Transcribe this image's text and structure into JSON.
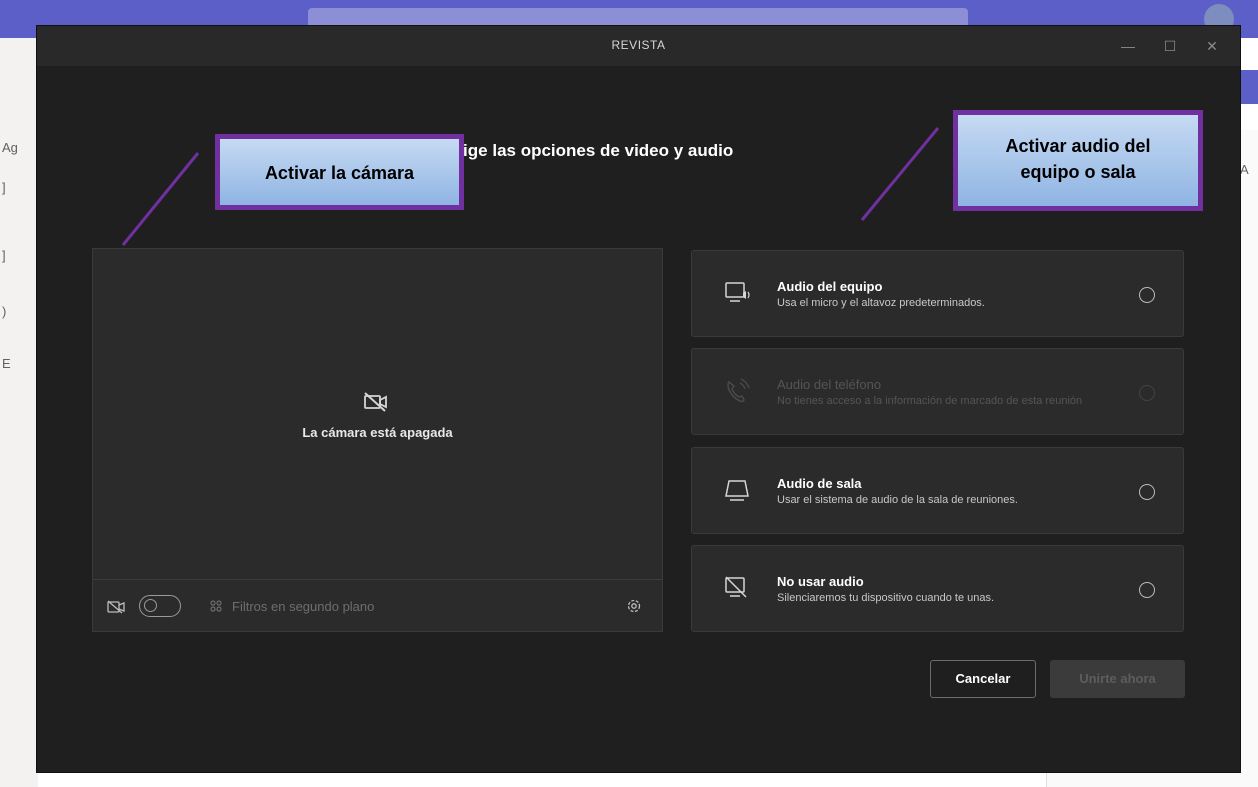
{
  "background_app": {
    "side_glyphs": [
      "Ag",
      "]",
      "]",
      ")",
      "E"
    ],
    "right_letter": "A"
  },
  "dialog": {
    "title": "REVISTA",
    "window_controls": {
      "minimize": "—",
      "maximize": "☐",
      "close": "✕"
    },
    "heading": "Elige las opciones de video y audio"
  },
  "annotations": {
    "camera_callout": "Activar la cámara",
    "audio_callout_line1": "Activar audio del",
    "audio_callout_line2": "equipo o sala",
    "color": "#7030a0"
  },
  "preview": {
    "camera_off_text": "La cámara está apagada",
    "filters_label": "Filtros en segundo plano",
    "camera_toggle_on": false
  },
  "audio_options": [
    {
      "title": "Audio del equipo",
      "description": "Usa el micro y el altavoz predeterminados.",
      "icon": "computer-audio-icon",
      "enabled": true
    },
    {
      "title": "Audio del teléfono",
      "description": "No tienes acceso a la información de marcado de esta reunión",
      "icon": "phone-icon",
      "enabled": false
    },
    {
      "title": "Audio de sala",
      "description": "Usar el sistema de audio de la sala de reuniones.",
      "icon": "room-audio-icon",
      "enabled": true
    },
    {
      "title": "No usar audio",
      "description": "Silenciaremos tu dispositivo cuando te unas.",
      "icon": "no-audio-icon",
      "enabled": true
    }
  ],
  "buttons": {
    "cancel": "Cancelar",
    "join": "Unirte ahora"
  },
  "colors": {
    "dialog_bg": "#1f1f1f",
    "teams_purple": "#5b5fc7"
  }
}
